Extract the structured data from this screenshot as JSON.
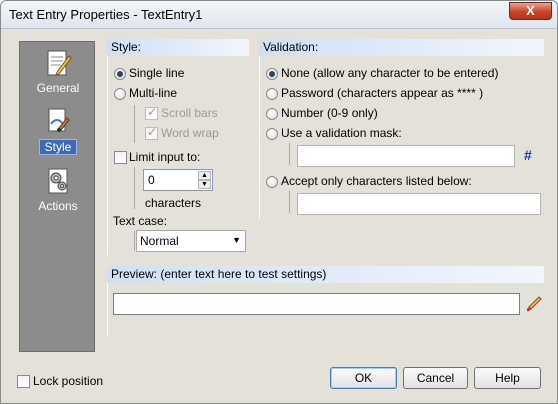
{
  "window": {
    "title": "Text Entry Properties - TextEntry1",
    "close_label": "X"
  },
  "sidebar": {
    "items": [
      {
        "label": "General",
        "icon": "document-pencil-icon"
      },
      {
        "label": "Style",
        "icon": "paint-brush-icon",
        "active": true
      },
      {
        "label": "Actions",
        "icon": "gears-icon"
      }
    ]
  },
  "style": {
    "header": "Style:",
    "single_line": "Single line",
    "multi_line": "Multi-line",
    "scroll_bars": "Scroll bars",
    "word_wrap": "Word wrap",
    "limit_input": "Limit input to:",
    "limit_value": "0",
    "characters": "characters",
    "text_case_label": "Text case:",
    "text_case_value": "Normal"
  },
  "validation": {
    "header": "Validation:",
    "none": "None (allow any character to be entered)",
    "password": "Password (characters appear as **** )",
    "number": "Number (0-9 only)",
    "use_mask": "Use a validation mask:",
    "mask_value": "",
    "mask_symbol": "#",
    "accept_only": "Accept only characters listed below:",
    "accept_value": ""
  },
  "preview": {
    "header": "Preview: (enter text here to test settings)",
    "value": ""
  },
  "footer": {
    "lock_position": "Lock position",
    "ok": "OK",
    "cancel": "Cancel",
    "help": "Help"
  }
}
